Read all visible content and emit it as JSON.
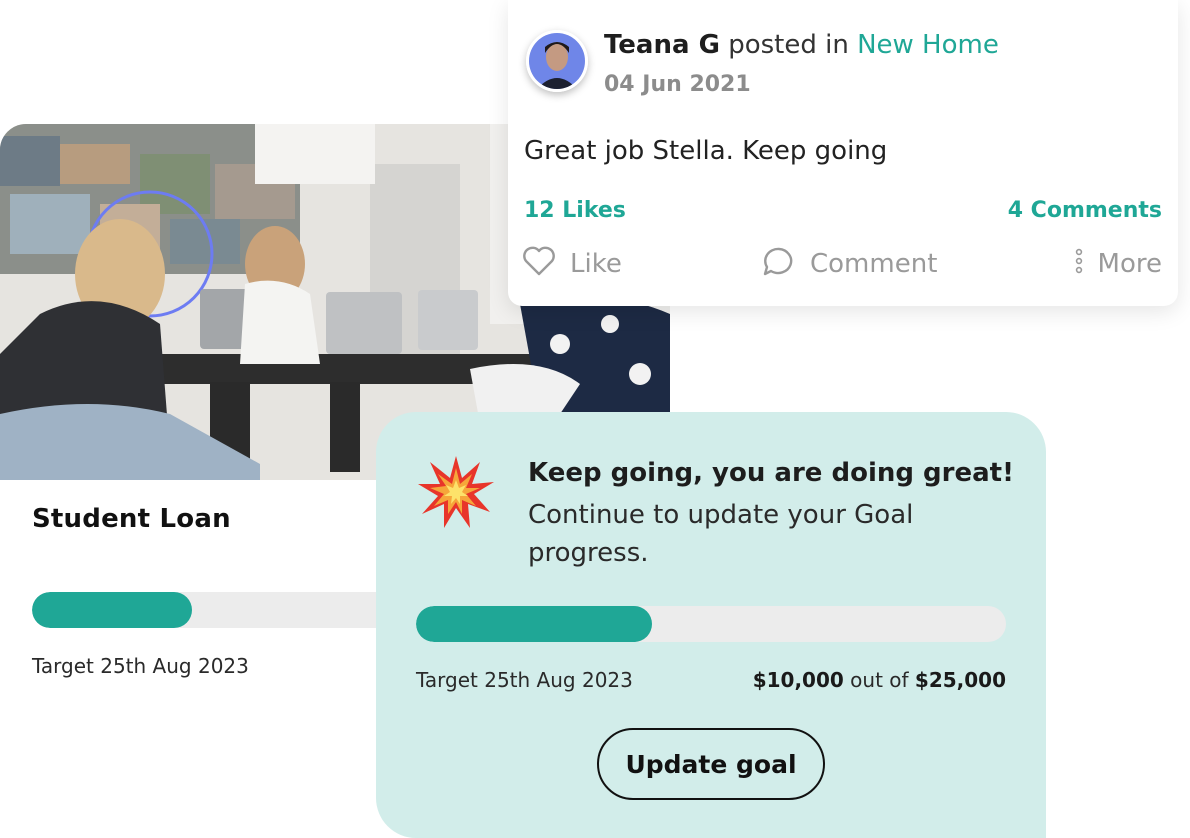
{
  "goal": {
    "title": "Student Loan",
    "progress": 0.4,
    "target": "Target 25th Aug 2023"
  },
  "post": {
    "author": "Teana G",
    "posted_in": "posted in",
    "group": "New Home",
    "date": "04 Jun 2021",
    "text": "Great job Stella. Keep going",
    "likes": "12 Likes",
    "comments": "4 Comments",
    "actions": {
      "like": "Like",
      "comment": "Comment",
      "more": "More"
    }
  },
  "encourage": {
    "heading": "Keep going, you are doing great!",
    "body": "Continue to update your Goal progress.",
    "progress": 0.4,
    "target": "Target 25th Aug 2023",
    "current_amount": "$10,000",
    "out_of": "out of",
    "goal_amount": "$25,000",
    "button": "Update goal"
  },
  "colors": {
    "accent": "#1fa796",
    "card_mint": "#d2edea",
    "track": "#ececec"
  },
  "icons": [
    "heart-icon",
    "comment-icon",
    "more-dots-icon",
    "collision-burst-icon"
  ]
}
